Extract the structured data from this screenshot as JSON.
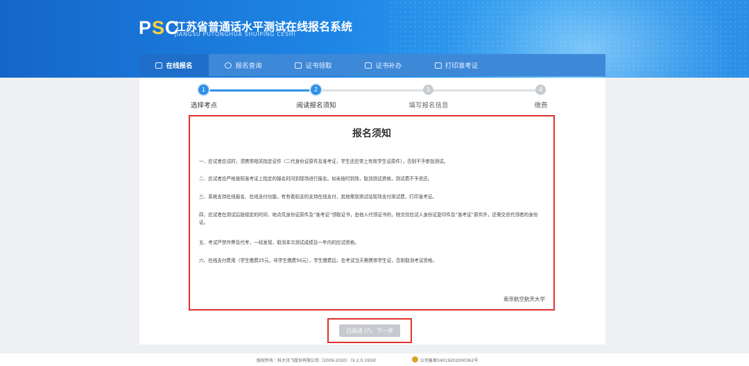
{
  "header": {
    "logo_mark_left": "P",
    "logo_mark_mid": "S",
    "logo_mark_right": "C",
    "title": "江苏省普通话水平测试在线报名系统",
    "subtitle": "JIANGSU PUTONGHUA SHUIPING CESHI"
  },
  "nav": {
    "items": [
      {
        "label": "在线报名",
        "icon": "edit-icon"
      },
      {
        "label": "报名查询",
        "icon": "search-icon"
      },
      {
        "label": "证书领取",
        "icon": "certificate-icon"
      },
      {
        "label": "证书补办",
        "icon": "certificate-icon"
      },
      {
        "label": "打印准考证",
        "icon": "printer-icon"
      }
    ]
  },
  "steps": [
    {
      "num": "1",
      "label": "选择考点"
    },
    {
      "num": "2",
      "label": "阅读报名须知"
    },
    {
      "num": "3",
      "label": "填写报名信息"
    },
    {
      "num": "4",
      "label": "缴费"
    }
  ],
  "notice": {
    "title": "报名须知",
    "paragraphs": [
      "一、应试者应试时，须携带相关指定证件（二代身份证原件及准考证，学生还应带上有效学生证原件），否则不予参加测试。",
      "二、应试者应严格按照准考证上指定的报名时间到现场进行报名。如未按时到场，取消测试资格，测试费不予退还。",
      "三、系统支持在线报名、在线支付功能，有有看标志的支持在线支付，其他需到测试站现场支付测试费，打印准考证。",
      "四、应试者在测试后按规定的时间、地点凭身份证原件及“准考证”领取证书，由他人代领证书的，除交验应试人身份证复印件及“准考证”原件外，还需交验代领者的身份证。",
      "五、考试严禁作弊及代考，一经发现，取消本次测试成绩及一年内的应试资格。",
      "六、在线支付费用（学生缴费25元，非学生缴费50元），学生缴费后，在考试当天需携带学生证，否则取消考试资格。"
    ],
    "school": "南京航空航天大学"
  },
  "next_button": {
    "label": "已阅读 (7)，下一步"
  },
  "footer": {
    "copyright": "版权所有：科大讯飞股份有限公司（2009-2020）（V 2.0.1959）",
    "icp": "公司备案34019202000362号"
  },
  "colors": {
    "primary": "#2f8fe6",
    "highlight_border": "#e0302a",
    "disabled": "#c6c9ce"
  }
}
